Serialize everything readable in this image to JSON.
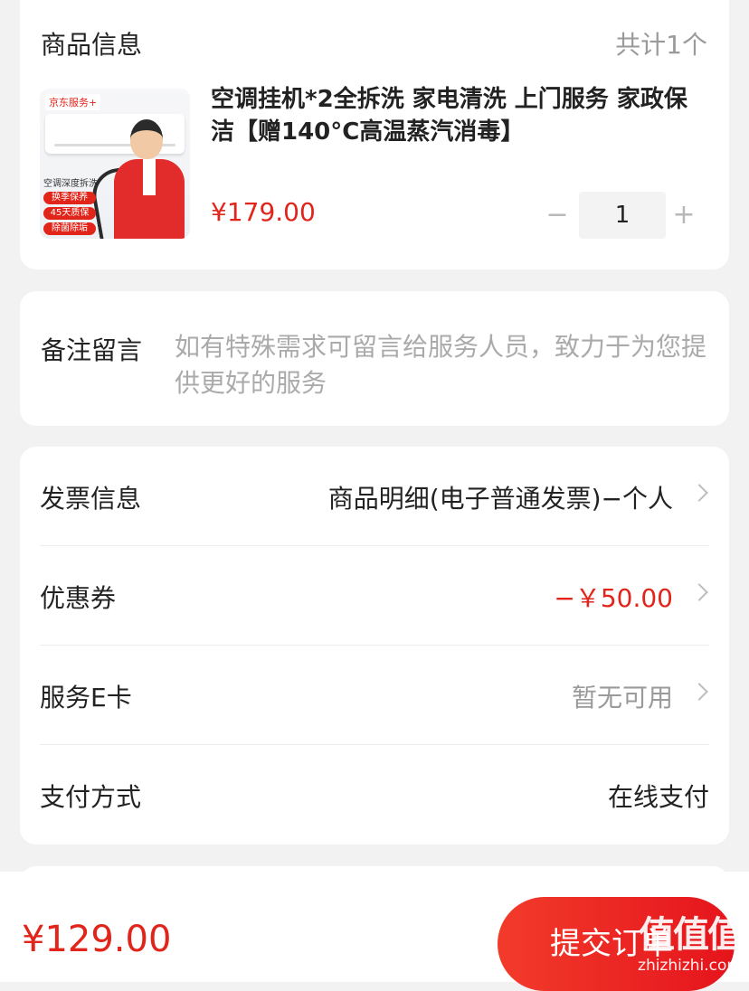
{
  "product_section": {
    "title": "商品信息",
    "count": "共计1个",
    "item": {
      "image_badge": "京东服务+",
      "image_caption": "空调深度拆洗",
      "image_tags": [
        "换季保养",
        "45天质保",
        "除菌除垢"
      ],
      "title": "空调挂机*2全拆洗 家电清洗 上门服务 家政保洁【赠140°C高温蒸汽消毒】",
      "price": "¥179.00",
      "quantity": "1",
      "minus": "−",
      "plus": "+"
    }
  },
  "remark": {
    "label": "备注留言",
    "placeholder": "如有特殊需求可留言给服务人员，致力于为您提供更好的服务"
  },
  "settings": {
    "invoice": {
      "label": "发票信息",
      "value": "商品明细(电子普通发票)−个人"
    },
    "coupon": {
      "label": "优惠券",
      "value": "−￥50.00",
      "color": "#e1251b"
    },
    "ecard": {
      "label": "服务E卡",
      "value": "暂无可用"
    },
    "payment": {
      "label": "支付方式",
      "value": "在线支付"
    }
  },
  "footer": {
    "total": "¥129.00",
    "submit_label": "提交订单"
  },
  "watermark": {
    "mark": "值值值",
    "site": "zhizhizhi.com"
  },
  "colors": {
    "accent": "#e1251b",
    "background": "#f2f2f2"
  }
}
